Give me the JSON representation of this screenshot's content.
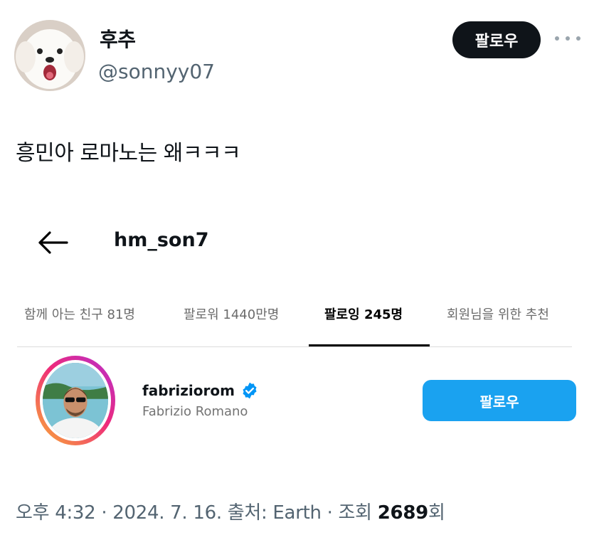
{
  "author": {
    "display_name": "후추",
    "handle": "@sonnyy07"
  },
  "follow_button": {
    "label": "팔로우"
  },
  "more_icon": "ellipsis-icon",
  "tweet_text": "흥민아 로마노는 왜ㅋㅋㅋ",
  "embedded": {
    "title": "hm_son7",
    "back_icon": "arrow-left-icon",
    "tabs": [
      {
        "label": "함께 아는 친구 81명"
      },
      {
        "label": "팔로워 1440만명"
      },
      {
        "label": "팔로잉 245명"
      },
      {
        "label": "회원님을 위한 추천"
      }
    ],
    "account": {
      "username": "fabriziorom",
      "name": "Fabrizio Romano",
      "verified_icon": "verified-badge-icon",
      "follow_label": "팔로우"
    }
  },
  "meta": {
    "text": "오후 4:32 · 2024. 7. 16. 출처: Earth · 조회 ",
    "views": "2689",
    "suffix": "회"
  },
  "colors": {
    "follow_dark": "#0f1419",
    "ig_blue": "#1aa2f0",
    "muted": "#536471",
    "verified": "#1d9bf0"
  }
}
